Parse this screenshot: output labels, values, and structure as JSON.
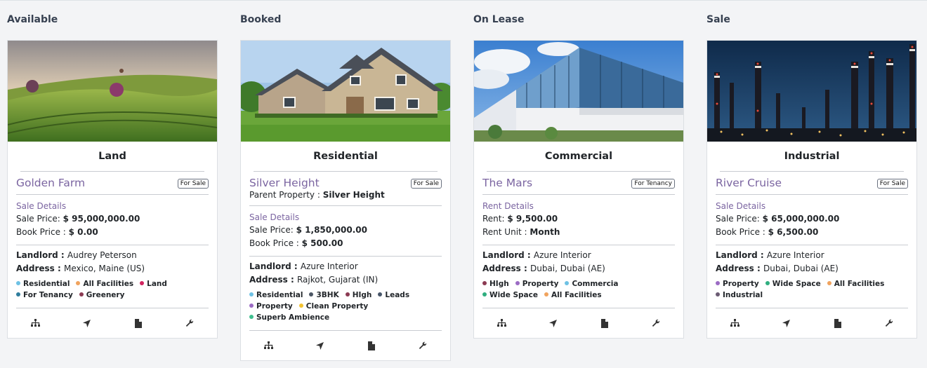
{
  "columns": [
    {
      "title": "Available",
      "type": "Land",
      "name": "Golden Farm",
      "badge": "For Sale",
      "parent_label": null,
      "parent_value": null,
      "details_title": "Sale Details",
      "detail_lines": [
        {
          "label": "Sale Price: ",
          "value": "$ 95,000,000.00"
        },
        {
          "label": "Book Price : ",
          "value": "$ 0.00"
        }
      ],
      "landlord_label": "Landlord : ",
      "landlord": "Audrey Peterson",
      "address_label": "Address : ",
      "address": "Mexico, Maine (US)",
      "tags": [
        {
          "label": "Residential",
          "color": "#6ec1e4"
        },
        {
          "label": "All Facilities",
          "color": "#f0a35e"
        },
        {
          "label": "Land",
          "color": "#d1245f"
        },
        {
          "label": "For Tenancy",
          "color": "#2f7d9d"
        },
        {
          "label": "Greenery",
          "color": "#8b3a52"
        }
      ]
    },
    {
      "title": "Booked",
      "type": "Residential",
      "name": "Silver Height",
      "badge": "For Sale",
      "parent_label": "Parent Property : ",
      "parent_value": "Silver Height",
      "details_title": "Sale Details",
      "detail_lines": [
        {
          "label": "Sale Price: ",
          "value": "$ 1,850,000.00"
        },
        {
          "label": "Book Price : ",
          "value": "$ 500.00"
        }
      ],
      "landlord_label": "Landlord : ",
      "landlord": "Azure Interior",
      "address_label": "Address : ",
      "address": "Rajkot, Gujarat (IN)",
      "tags": [
        {
          "label": "Residential",
          "color": "#6ec1e4"
        },
        {
          "label": "3BHK",
          "color": "#4b5563"
        },
        {
          "label": "HIgh",
          "color": "#8b3a52"
        },
        {
          "label": "Leads",
          "color": "#475569"
        },
        {
          "label": "Property",
          "color": "#9b6bc4"
        },
        {
          "label": "Clean Property",
          "color": "#f2c230"
        },
        {
          "label": "Superb Ambience",
          "color": "#3fbf8f"
        }
      ]
    },
    {
      "title": "On Lease",
      "type": "Commercial",
      "name": "The Mars",
      "badge": "For Tenancy",
      "parent_label": null,
      "parent_value": null,
      "details_title": "Rent Details",
      "detail_lines": [
        {
          "label": "Rent: ",
          "value": "$ 9,500.00"
        },
        {
          "label": "Rent Unit : ",
          "value": "Month"
        }
      ],
      "landlord_label": "Landlord : ",
      "landlord": "Azure Interior",
      "address_label": "Address : ",
      "address": "Dubai, Dubai (AE)",
      "tags": [
        {
          "label": "HIgh",
          "color": "#8b3a52"
        },
        {
          "label": "Property",
          "color": "#9b6bc4"
        },
        {
          "label": "Commercia",
          "color": "#6ec1e4"
        },
        {
          "label": "Wide Space",
          "color": "#2fae7f"
        },
        {
          "label": "All Facilities",
          "color": "#f0a35e"
        }
      ]
    },
    {
      "title": "Sale",
      "type": "Industrial",
      "name": "River Cruise",
      "badge": "For Sale",
      "parent_label": null,
      "parent_value": null,
      "details_title": "Sale Details",
      "detail_lines": [
        {
          "label": "Sale Price: ",
          "value": "$ 65,000,000.00"
        },
        {
          "label": "Book Price : ",
          "value": "$ 6,500.00"
        }
      ],
      "landlord_label": "Landlord : ",
      "landlord": "Azure Interior",
      "address_label": "Address : ",
      "address": "Dubai, Dubai (AE)",
      "tags": [
        {
          "label": "Property",
          "color": "#9b6bc4"
        },
        {
          "label": "Wide Space",
          "color": "#2fae7f"
        },
        {
          "label": "All Facilities",
          "color": "#f0a35e"
        },
        {
          "label": "Industrial",
          "color": "#6b5b73"
        }
      ]
    }
  ],
  "action_icons": [
    "sitemap-icon",
    "location-arrow-icon",
    "document-icon",
    "wrench-icon"
  ],
  "colors": {
    "accent_purple": "#7b65a1",
    "page_background": "#f3f4f6"
  }
}
